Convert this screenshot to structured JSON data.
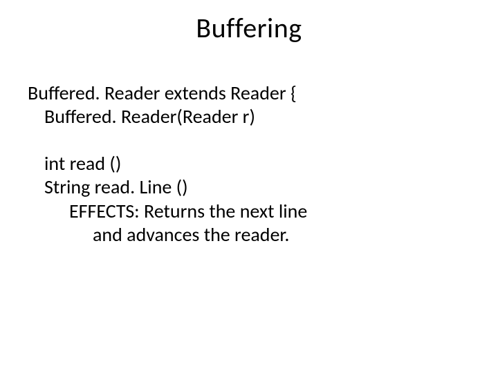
{
  "title": "Buffering",
  "lines": {
    "class_decl": "Buffered. Reader extends Reader {",
    "ctor": "Buffered. Reader(Reader r)",
    "read": "int read ()",
    "readline": "String read. Line ()",
    "effects": "EFFECTS: Returns the next line",
    "effects2": "and advances the reader."
  }
}
